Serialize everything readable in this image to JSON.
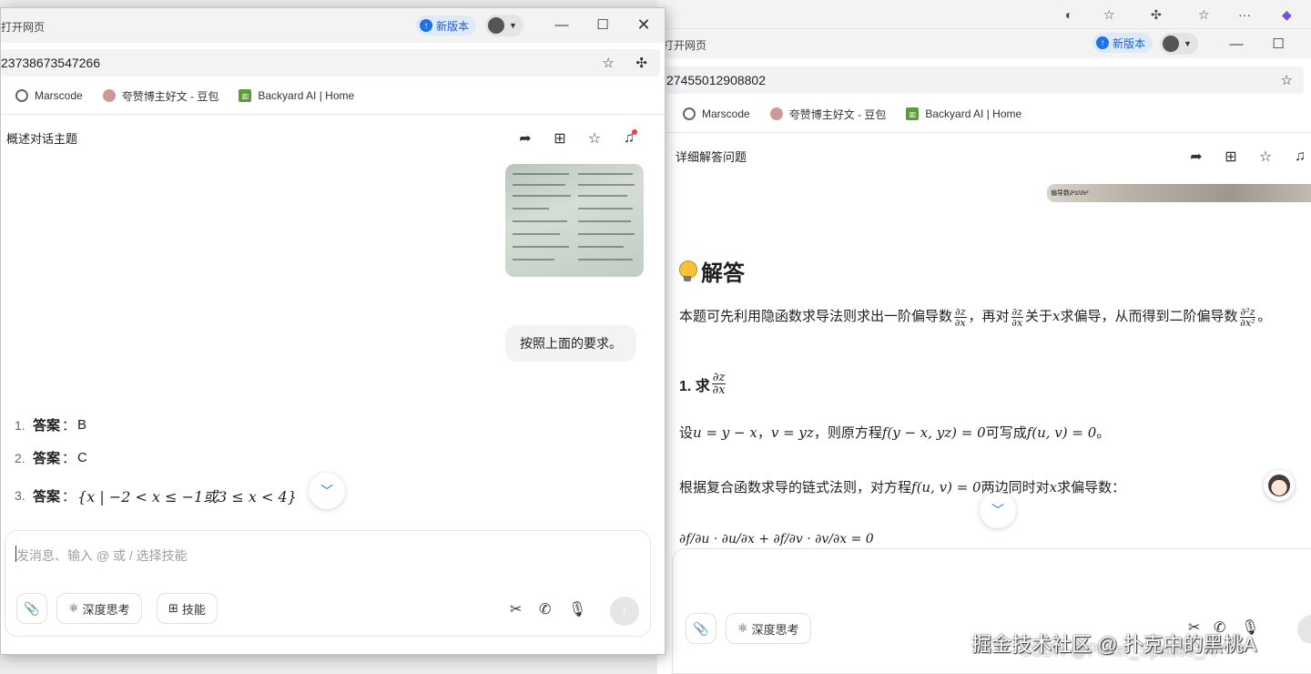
{
  "right_window": {
    "tab_title": "打开网页",
    "new_version_label": "新版本",
    "url": "27455012908802",
    "bookmarks": [
      {
        "label": "Marscode",
        "icon": "globe-icon"
      },
      {
        "label": "夸赞博主好文 - 豆包",
        "icon": "doubao-avatar-icon"
      },
      {
        "label": "Backyard AI | Home",
        "icon": "backyard-grid-icon"
      }
    ],
    "chat_title": "详细解答问题",
    "image_strip_text": "偏导数∂²z/∂x²",
    "answer_heading": "解答",
    "intro_pre": "本题可先利用隐函数求导法则求出一阶偏导数",
    "intro_mid1": "，再对",
    "intro_mid2": "关于",
    "intro_x": "x",
    "intro_mid3": "求偏导，从而得到二阶偏导数",
    "intro_end": "。",
    "frac_dz": {
      "num": "∂z",
      "den": "∂x"
    },
    "frac_d2z": {
      "num": "∂²z",
      "den": "∂x²"
    },
    "step1_label": "1. 求",
    "step1_text_pre": "设",
    "step1_math1": "u = y − x",
    "step1_sep": "，",
    "step1_math2": "v = yz",
    "step1_text_mid": "，则原方程",
    "step1_math3": "f(y − x, yz) = 0",
    "step1_text_mid2": "可写成",
    "step1_math4": "f(u, v) = 0",
    "step1_text_end": "。",
    "chain_pre": "根据复合函数求导的链式法则，对方程",
    "chain_math": "f(u, v) = 0",
    "chain_post": "两边同时对",
    "chain_x": "x",
    "chain_end": "求偏导数：",
    "partial_formula": "∂f/∂u · ∂u/∂x + ∂f/∂v · ∂v/∂x = 0",
    "deep_think_label": "深度思考",
    "watermark": "掘金技术社区 @ 扑克中的黑桃A",
    "watermark2": "CSDN @Poker_Spades_A"
  },
  "left_window": {
    "tab_title": "打开网页",
    "new_version_label": "新版本",
    "url": "23738673547266",
    "bookmarks": [
      {
        "label": "Marscode",
        "icon": "globe-icon"
      },
      {
        "label": "夸赞博主好文 - 豆包",
        "icon": "doubao-avatar-icon"
      },
      {
        "label": "Backyard AI | Home",
        "icon": "backyard-grid-icon"
      }
    ],
    "chat_title": "概述对话主题",
    "user_message": "按照上面的要求。",
    "answers": [
      {
        "no": "1.",
        "label": "答案",
        "colon": "：",
        "value": "B"
      },
      {
        "no": "2.",
        "label": "答案",
        "colon": "：",
        "value": "C"
      },
      {
        "no": "3.",
        "label": "答案",
        "colon": "：",
        "value": "{x | −2 < x ≤ −1或3 ≤ x < 4}"
      }
    ],
    "input_placeholder": "发消息、输入 @ 或 / 选择技能",
    "deep_think_label": "深度思考",
    "skills_label": "技能"
  }
}
